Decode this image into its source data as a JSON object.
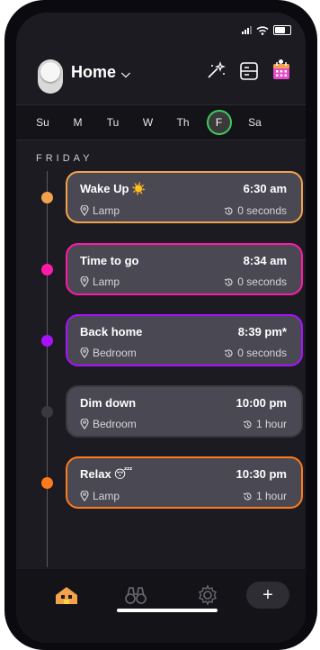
{
  "header": {
    "home_label": "Home"
  },
  "week": {
    "days": [
      "Su",
      "M",
      "Tu",
      "W",
      "Th",
      "F",
      "Sa"
    ],
    "active_day": "F"
  },
  "section": {
    "label": "FRIDAY"
  },
  "routines": [
    {
      "name": "Wake Up",
      "emoji": "☀️",
      "time": "6:30 am",
      "location": "Lamp",
      "duration": "0 seconds",
      "color": "#f2a24a"
    },
    {
      "name": "Time to go",
      "emoji": "",
      "time": "8:34 am",
      "location": "Lamp",
      "duration": "0 seconds",
      "color": "#ff1aa8"
    },
    {
      "name": "Back home",
      "emoji": "",
      "time": "8:39 pm*",
      "location": "Bedroom",
      "duration": "0 seconds",
      "color": "#a812ff"
    },
    {
      "name": "Dim down",
      "emoji": "",
      "time": "10:00 pm",
      "location": "Bedroom",
      "duration": "1 hour",
      "color": "#3a3940"
    },
    {
      "name": "Relax",
      "emoji": "😴",
      "time": "10:30 pm",
      "location": "Lamp",
      "duration": "1 hour",
      "color": "#ff7a1a"
    }
  ],
  "bottom_nav": {
    "add_label": "+"
  },
  "icons": {
    "home": "home-icon",
    "explore": "binoculars-icon",
    "settings": "gear-icon",
    "location": "pin-icon",
    "duration": "history-icon"
  }
}
